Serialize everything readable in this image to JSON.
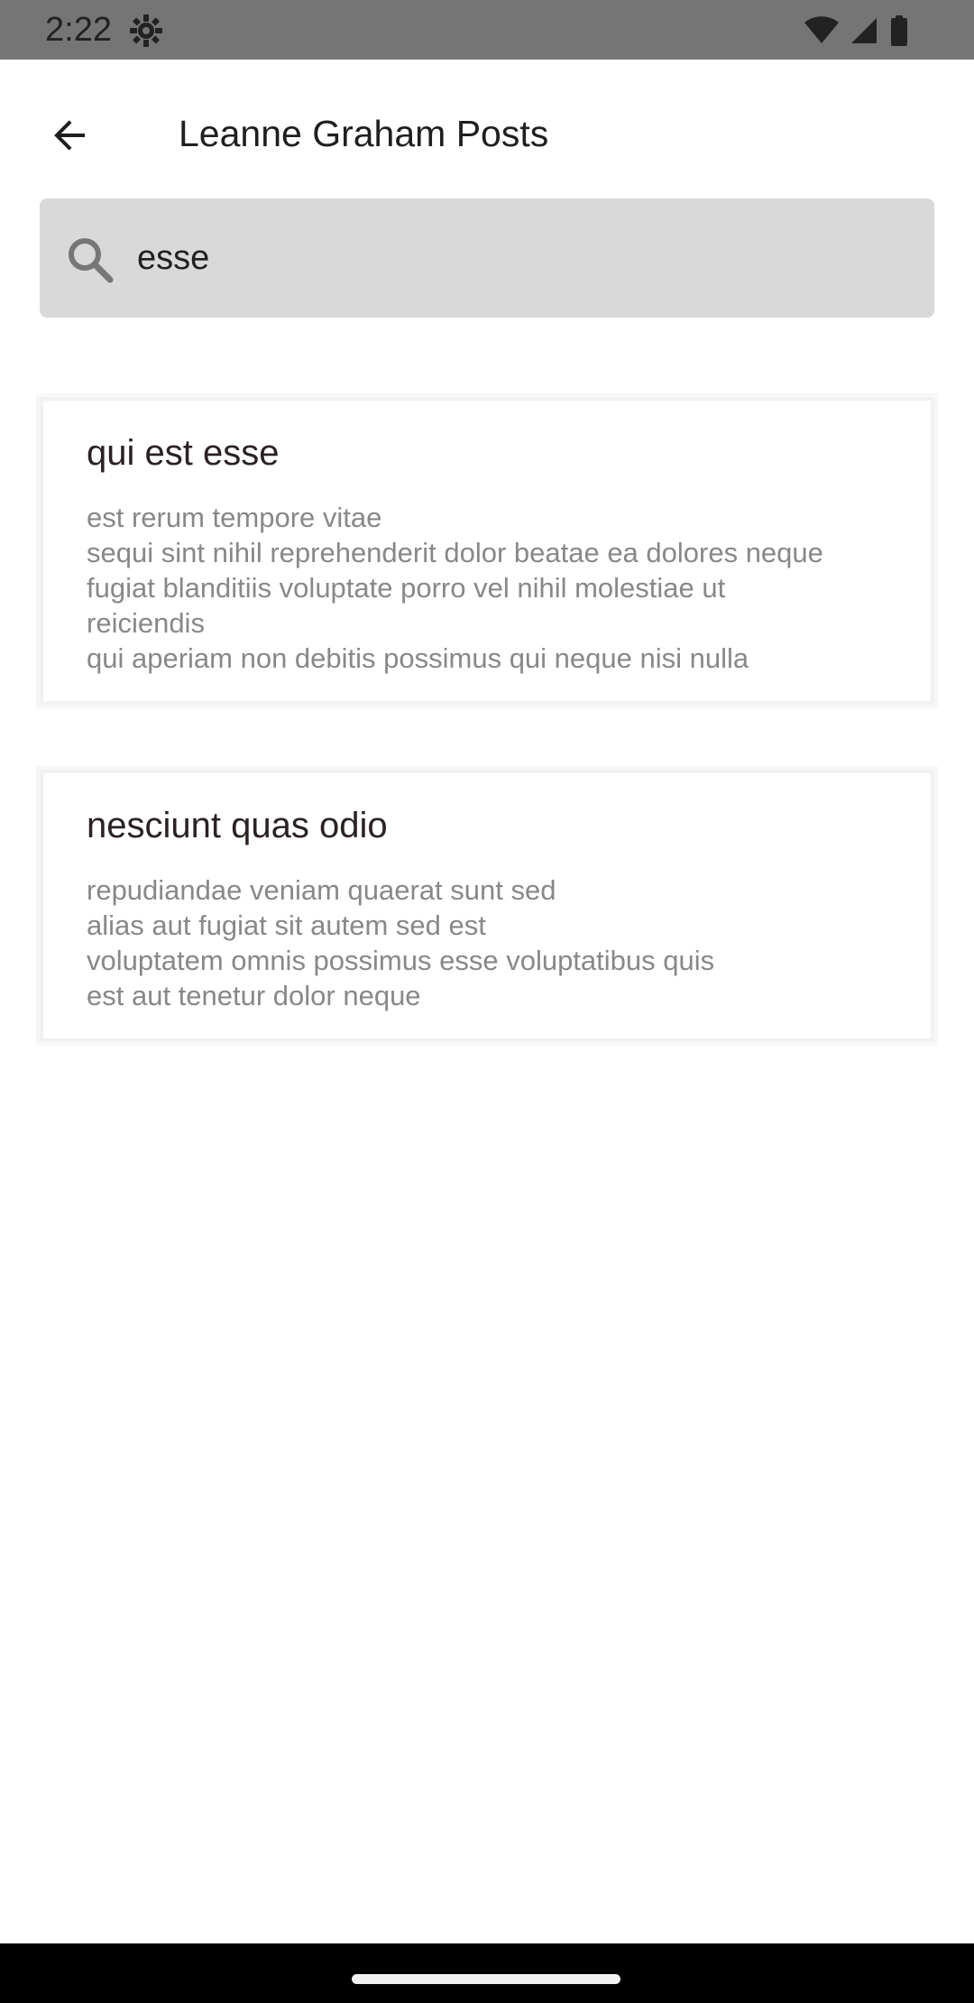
{
  "status_bar": {
    "time": "2:22"
  },
  "app_bar": {
    "title": "Leanne Graham Posts",
    "back_icon": "arrow-back-icon"
  },
  "search": {
    "value": "esse",
    "icon": "search-icon"
  },
  "posts": [
    {
      "title": "qui est esse",
      "body_lines": [
        "est rerum tempore vitae",
        "sequi sint nihil reprehenderit dolor beatae ea dolores neque",
        "fugiat blanditiis voluptate porro vel nihil molestiae ut",
        "reiciendis",
        "qui aperiam non debitis possimus qui neque nisi nulla"
      ]
    },
    {
      "title": "nesciunt quas odio",
      "body_lines": [
        "repudiandae veniam quaerat sunt sed",
        "alias aut fugiat sit autem sed est",
        "voluptatem omnis possimus esse voluptatibus quis",
        "est aut tenetur dolor neque"
      ]
    }
  ],
  "colors": {
    "status_bar": "#757575",
    "search_background": "#d9d9d9",
    "title_text": "#1f1f1f",
    "body_text": "#888888",
    "navigation_bar": "#000000"
  }
}
